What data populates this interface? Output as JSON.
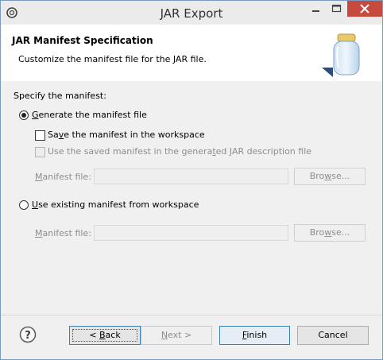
{
  "window": {
    "title": "JAR Export"
  },
  "header": {
    "title": "JAR Manifest Specification",
    "description": "Customize the manifest file for the JAR file."
  },
  "form": {
    "section_label": "Specify the manifest:",
    "option_generate": {
      "label_pre": "",
      "mnemonic": "G",
      "label_post": "enerate the manifest file",
      "selected": true
    },
    "save_manifest": {
      "label_pre": "Sa",
      "mnemonic": "v",
      "label_post": "e the manifest in the workspace",
      "checked": false,
      "enabled": true
    },
    "use_saved_manifest": {
      "label_pre": "Use the saved manifest in the genera",
      "mnemonic": "t",
      "label_post": "ed JAR description file",
      "checked": false,
      "enabled": false
    },
    "manifest_file_1": {
      "label_pre": "",
      "mnemonic": "M",
      "label_post": "anifest file:",
      "value": "",
      "browse": {
        "pre": "Bro",
        "mnemonic": "w",
        "post": "se..."
      }
    },
    "option_existing": {
      "label_pre": "",
      "mnemonic": "U",
      "label_post": "se existing manifest from workspace",
      "selected": false
    },
    "manifest_file_2": {
      "label_pre": "",
      "mnemonic": "M",
      "label_post": "anifest file:",
      "value": "",
      "browse": {
        "pre": "Bro",
        "mnemonic": "w",
        "post": "se..."
      }
    }
  },
  "footer": {
    "back": {
      "pre": "< ",
      "mnemonic": "B",
      "post": "ack"
    },
    "next": {
      "pre": "",
      "mnemonic": "N",
      "post": "ext >"
    },
    "finish": {
      "pre": "",
      "mnemonic": "F",
      "post": "inish"
    },
    "cancel": "Cancel"
  },
  "icons": {
    "app": "eclipse-icon",
    "banner": "jar-icon",
    "help": "help-icon"
  },
  "colors": {
    "close_button": "#c74a3e",
    "focus_border": "#3c7fb1"
  }
}
